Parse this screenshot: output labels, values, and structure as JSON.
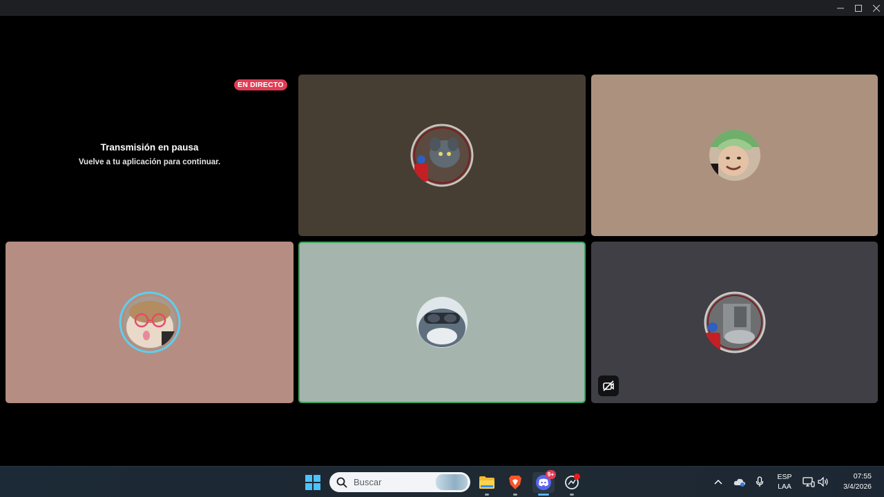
{
  "window": {
    "controls": {
      "minimize_icon": "minimize-icon",
      "maximize_icon": "maximize-icon",
      "close_icon": "close-icon"
    }
  },
  "stage": {
    "stream_tile": {
      "live_badge": "EN DIRECTO",
      "title": "Transmisión en pausa",
      "subtitle": "Vuelve a tu aplicación para continuar."
    },
    "participants": [
      {
        "avatar": "cat-avatar-with-decoration",
        "bg_color": "#463e33",
        "speaking": false
      },
      {
        "avatar": "person-selfie-avatar",
        "bg_color": "#ad917f",
        "speaking": false
      },
      {
        "avatar": "hamster-glasses-avatar",
        "bg_color": "#b68d82",
        "speaking": false,
        "ring_color": "#5ad1f0"
      },
      {
        "avatar": "shark-goggles-avatar",
        "bg_color": "#a6b4ae",
        "speaking": true,
        "ring_color": "#3ba55c"
      },
      {
        "avatar": "photo-avatar-with-decoration",
        "bg_color": "#3f3f45",
        "speaking": false,
        "camera_off_icon": "camera-off-icon"
      }
    ]
  },
  "taskbar": {
    "search_placeholder": "Buscar",
    "apps": [
      {
        "icon": "windows-start-icon"
      },
      {
        "icon": "file-explorer-icon"
      },
      {
        "icon": "brave-browser-icon"
      },
      {
        "icon": "discord-icon",
        "badge": "9+"
      },
      {
        "icon": "app-icon"
      }
    ],
    "tray": {
      "language": "ESP",
      "layout": "LAA",
      "time": "07:55",
      "date": "3/4/2026"
    }
  },
  "colors": {
    "live_red": "#e23c55",
    "speaking_green": "#3ba55c",
    "discord_blurple": "#5865f2"
  }
}
